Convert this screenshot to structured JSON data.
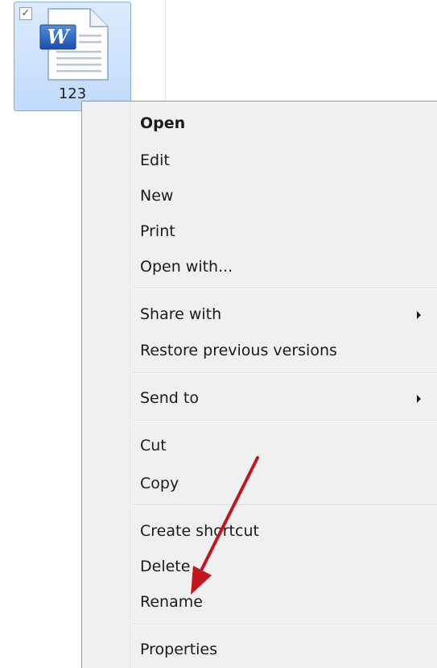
{
  "file": {
    "name": "123",
    "icon": "word-document-icon",
    "selected": true
  },
  "menu": {
    "groups": [
      {
        "items": [
          {
            "label": "Open",
            "bold": true
          },
          {
            "label": "Edit"
          },
          {
            "label": "New"
          },
          {
            "label": "Print"
          },
          {
            "label": "Open with..."
          }
        ]
      },
      {
        "items": [
          {
            "label": "Share with",
            "submenu": true
          },
          {
            "label": "Restore previous versions"
          }
        ]
      },
      {
        "items": [
          {
            "label": "Send to",
            "submenu": true
          }
        ]
      },
      {
        "items": [
          {
            "label": "Cut"
          },
          {
            "label": "Copy"
          }
        ]
      },
      {
        "items": [
          {
            "label": "Create shortcut"
          },
          {
            "label": "Delete"
          },
          {
            "label": "Rename"
          }
        ]
      },
      {
        "items": [
          {
            "label": "Properties"
          }
        ]
      }
    ]
  },
  "annotation": {
    "type": "red-arrow",
    "target": "Rename",
    "color": "#c4161c"
  },
  "colors": {
    "selection_fill": "#c1dbfc",
    "selection_border": "#84acdd",
    "menu_background": "#f0f0f0",
    "menu_border": "#979797"
  }
}
